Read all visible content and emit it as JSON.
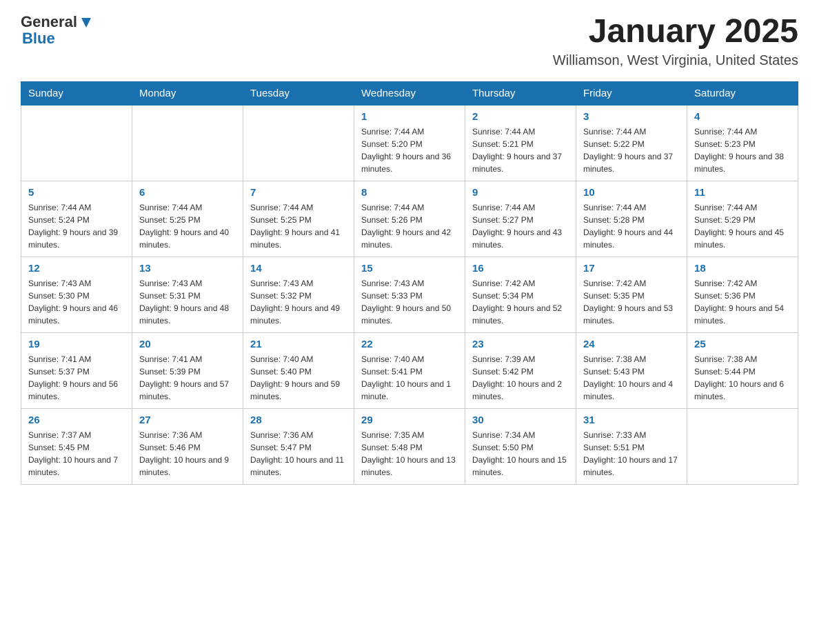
{
  "header": {
    "logo": {
      "text_general": "General",
      "text_blue": "Blue"
    },
    "title": "January 2025",
    "subtitle": "Williamson, West Virginia, United States"
  },
  "days_of_week": [
    "Sunday",
    "Monday",
    "Tuesday",
    "Wednesday",
    "Thursday",
    "Friday",
    "Saturday"
  ],
  "weeks": [
    [
      {
        "day": "",
        "info": ""
      },
      {
        "day": "",
        "info": ""
      },
      {
        "day": "",
        "info": ""
      },
      {
        "day": "1",
        "info": "Sunrise: 7:44 AM\nSunset: 5:20 PM\nDaylight: 9 hours and 36 minutes."
      },
      {
        "day": "2",
        "info": "Sunrise: 7:44 AM\nSunset: 5:21 PM\nDaylight: 9 hours and 37 minutes."
      },
      {
        "day": "3",
        "info": "Sunrise: 7:44 AM\nSunset: 5:22 PM\nDaylight: 9 hours and 37 minutes."
      },
      {
        "day": "4",
        "info": "Sunrise: 7:44 AM\nSunset: 5:23 PM\nDaylight: 9 hours and 38 minutes."
      }
    ],
    [
      {
        "day": "5",
        "info": "Sunrise: 7:44 AM\nSunset: 5:24 PM\nDaylight: 9 hours and 39 minutes."
      },
      {
        "day": "6",
        "info": "Sunrise: 7:44 AM\nSunset: 5:25 PM\nDaylight: 9 hours and 40 minutes."
      },
      {
        "day": "7",
        "info": "Sunrise: 7:44 AM\nSunset: 5:25 PM\nDaylight: 9 hours and 41 minutes."
      },
      {
        "day": "8",
        "info": "Sunrise: 7:44 AM\nSunset: 5:26 PM\nDaylight: 9 hours and 42 minutes."
      },
      {
        "day": "9",
        "info": "Sunrise: 7:44 AM\nSunset: 5:27 PM\nDaylight: 9 hours and 43 minutes."
      },
      {
        "day": "10",
        "info": "Sunrise: 7:44 AM\nSunset: 5:28 PM\nDaylight: 9 hours and 44 minutes."
      },
      {
        "day": "11",
        "info": "Sunrise: 7:44 AM\nSunset: 5:29 PM\nDaylight: 9 hours and 45 minutes."
      }
    ],
    [
      {
        "day": "12",
        "info": "Sunrise: 7:43 AM\nSunset: 5:30 PM\nDaylight: 9 hours and 46 minutes."
      },
      {
        "day": "13",
        "info": "Sunrise: 7:43 AM\nSunset: 5:31 PM\nDaylight: 9 hours and 48 minutes."
      },
      {
        "day": "14",
        "info": "Sunrise: 7:43 AM\nSunset: 5:32 PM\nDaylight: 9 hours and 49 minutes."
      },
      {
        "day": "15",
        "info": "Sunrise: 7:43 AM\nSunset: 5:33 PM\nDaylight: 9 hours and 50 minutes."
      },
      {
        "day": "16",
        "info": "Sunrise: 7:42 AM\nSunset: 5:34 PM\nDaylight: 9 hours and 52 minutes."
      },
      {
        "day": "17",
        "info": "Sunrise: 7:42 AM\nSunset: 5:35 PM\nDaylight: 9 hours and 53 minutes."
      },
      {
        "day": "18",
        "info": "Sunrise: 7:42 AM\nSunset: 5:36 PM\nDaylight: 9 hours and 54 minutes."
      }
    ],
    [
      {
        "day": "19",
        "info": "Sunrise: 7:41 AM\nSunset: 5:37 PM\nDaylight: 9 hours and 56 minutes."
      },
      {
        "day": "20",
        "info": "Sunrise: 7:41 AM\nSunset: 5:39 PM\nDaylight: 9 hours and 57 minutes."
      },
      {
        "day": "21",
        "info": "Sunrise: 7:40 AM\nSunset: 5:40 PM\nDaylight: 9 hours and 59 minutes."
      },
      {
        "day": "22",
        "info": "Sunrise: 7:40 AM\nSunset: 5:41 PM\nDaylight: 10 hours and 1 minute."
      },
      {
        "day": "23",
        "info": "Sunrise: 7:39 AM\nSunset: 5:42 PM\nDaylight: 10 hours and 2 minutes."
      },
      {
        "day": "24",
        "info": "Sunrise: 7:38 AM\nSunset: 5:43 PM\nDaylight: 10 hours and 4 minutes."
      },
      {
        "day": "25",
        "info": "Sunrise: 7:38 AM\nSunset: 5:44 PM\nDaylight: 10 hours and 6 minutes."
      }
    ],
    [
      {
        "day": "26",
        "info": "Sunrise: 7:37 AM\nSunset: 5:45 PM\nDaylight: 10 hours and 7 minutes."
      },
      {
        "day": "27",
        "info": "Sunrise: 7:36 AM\nSunset: 5:46 PM\nDaylight: 10 hours and 9 minutes."
      },
      {
        "day": "28",
        "info": "Sunrise: 7:36 AM\nSunset: 5:47 PM\nDaylight: 10 hours and 11 minutes."
      },
      {
        "day": "29",
        "info": "Sunrise: 7:35 AM\nSunset: 5:48 PM\nDaylight: 10 hours and 13 minutes."
      },
      {
        "day": "30",
        "info": "Sunrise: 7:34 AM\nSunset: 5:50 PM\nDaylight: 10 hours and 15 minutes."
      },
      {
        "day": "31",
        "info": "Sunrise: 7:33 AM\nSunset: 5:51 PM\nDaylight: 10 hours and 17 minutes."
      },
      {
        "day": "",
        "info": ""
      }
    ]
  ]
}
